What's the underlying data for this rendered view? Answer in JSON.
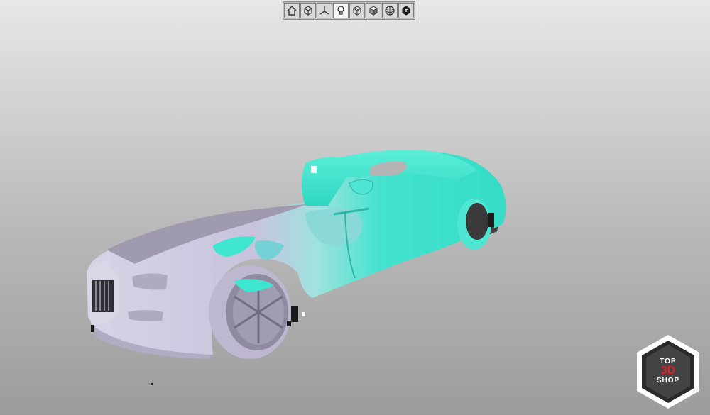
{
  "toolbar": {
    "buttons": [
      {
        "icon": "home-icon",
        "active": false
      },
      {
        "icon": "view-cube-icon",
        "active": false
      },
      {
        "icon": "axes-icon",
        "active": false
      },
      {
        "icon": "light-bulb-icon",
        "active": true
      },
      {
        "icon": "wireframe-cube-icon",
        "active": false
      },
      {
        "icon": "shaded-cube-icon",
        "active": false
      },
      {
        "icon": "sphere-icon",
        "active": false
      },
      {
        "icon": "texture-cube-icon",
        "active": false
      }
    ]
  },
  "scene": {
    "model": "car-scan",
    "colors": {
      "background_top": "#e7e7e7",
      "background_bottom": "#9c9c9c",
      "scan_surface": "#c6c2dc",
      "aligned_surface": "#3ee6cf",
      "tire": "#bdb8cf"
    }
  },
  "logo": {
    "top": "TOP",
    "main": "3D",
    "bottom": "SHOP",
    "accent_color": "#d8232a"
  }
}
